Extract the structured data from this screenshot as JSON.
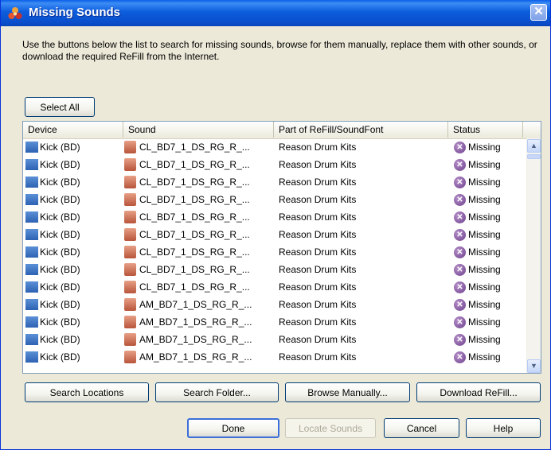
{
  "window": {
    "title": "Missing Sounds",
    "close_symbol": "✕"
  },
  "instructions": "Use the buttons below the list to search for missing sounds, browse for them manually, replace them with other sounds, or download the required ReFill from the Internet.",
  "select_all_label": "Select All",
  "list": {
    "columns": [
      "Device",
      "Sound",
      "Part of ReFill/SoundFont",
      "Status"
    ],
    "rows": [
      {
        "device": "Kick (BD)",
        "sound": "CL_BD7_1_DS_RG_R_...",
        "refill": "Reason Drum Kits",
        "status": "Missing"
      },
      {
        "device": "Kick (BD)",
        "sound": "CL_BD7_1_DS_RG_R_...",
        "refill": "Reason Drum Kits",
        "status": "Missing"
      },
      {
        "device": "Kick (BD)",
        "sound": "CL_BD7_1_DS_RG_R_...",
        "refill": "Reason Drum Kits",
        "status": "Missing"
      },
      {
        "device": "Kick (BD)",
        "sound": "CL_BD7_1_DS_RG_R_...",
        "refill": "Reason Drum Kits",
        "status": "Missing"
      },
      {
        "device": "Kick (BD)",
        "sound": "CL_BD7_1_DS_RG_R_...",
        "refill": "Reason Drum Kits",
        "status": "Missing"
      },
      {
        "device": "Kick (BD)",
        "sound": "CL_BD7_1_DS_RG_R_...",
        "refill": "Reason Drum Kits",
        "status": "Missing"
      },
      {
        "device": "Kick (BD)",
        "sound": "CL_BD7_1_DS_RG_R_...",
        "refill": "Reason Drum Kits",
        "status": "Missing"
      },
      {
        "device": "Kick (BD)",
        "sound": "CL_BD7_1_DS_RG_R_...",
        "refill": "Reason Drum Kits",
        "status": "Missing"
      },
      {
        "device": "Kick (BD)",
        "sound": "CL_BD7_1_DS_RG_R_...",
        "refill": "Reason Drum Kits",
        "status": "Missing"
      },
      {
        "device": "Kick (BD)",
        "sound": "AM_BD7_1_DS_RG_R_...",
        "refill": "Reason Drum Kits",
        "status": "Missing"
      },
      {
        "device": "Kick (BD)",
        "sound": "AM_BD7_1_DS_RG_R_...",
        "refill": "Reason Drum Kits",
        "status": "Missing"
      },
      {
        "device": "Kick (BD)",
        "sound": "AM_BD7_1_DS_RG_R_...",
        "refill": "Reason Drum Kits",
        "status": "Missing"
      },
      {
        "device": "Kick (BD)",
        "sound": "AM_BD7_1_DS_RG_R_...",
        "refill": "Reason Drum Kits",
        "status": "Missing"
      }
    ],
    "scroll_up": "▲",
    "scroll_down": "▼",
    "icons": {
      "device": "device-icon",
      "sound": "sample-file-icon",
      "status": "missing-x-icon"
    },
    "missing_mark": "✕"
  },
  "action_buttons": {
    "search_locations": "Search Locations",
    "search_folder": "Search Folder...",
    "browse_manually": "Browse Manually...",
    "download_refill": "Download ReFill..."
  },
  "footer_buttons": {
    "done": "Done",
    "locate_sounds": "Locate Sounds",
    "cancel": "Cancel",
    "help": "Help"
  },
  "colors": {
    "titlebar": "#0A5FE6",
    "dialog_bg": "#ECE9D8",
    "missing_icon": "#6B3F8C"
  }
}
